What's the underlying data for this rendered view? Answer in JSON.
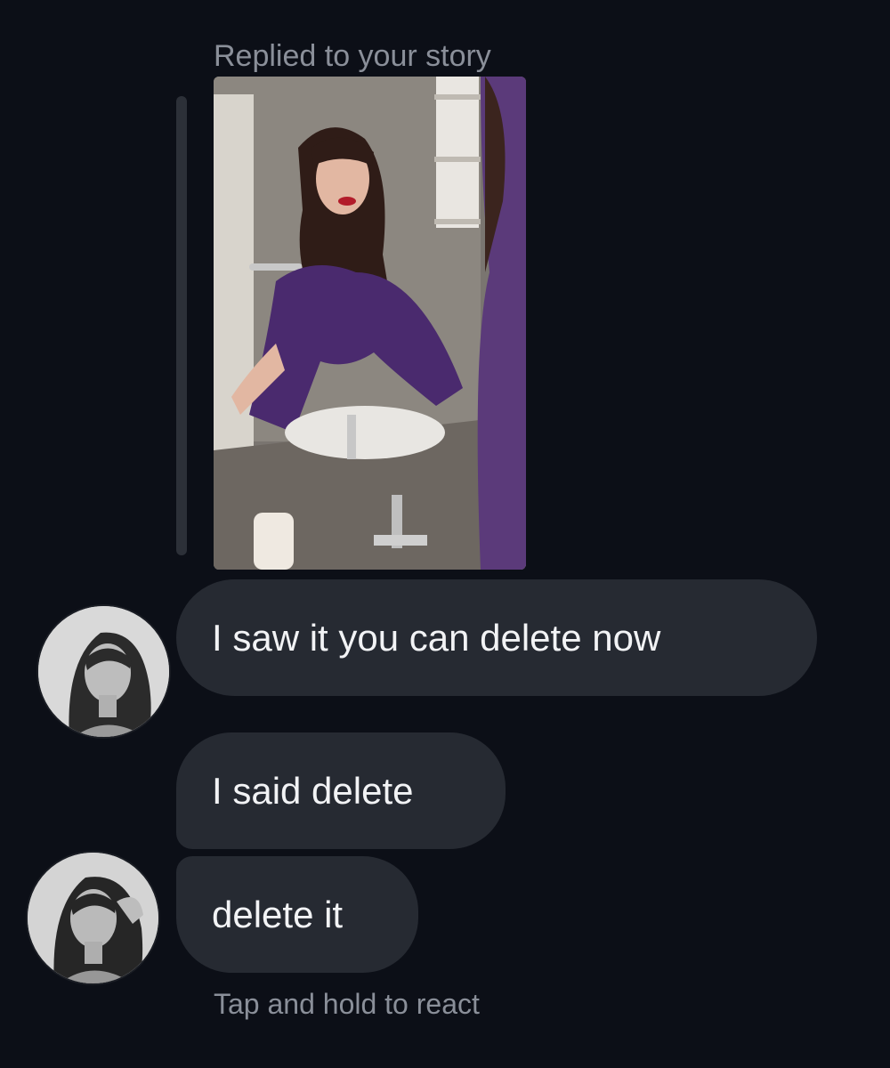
{
  "thread": {
    "replied_label": "Replied to your story",
    "story_thumbnail": "story-photo",
    "messages": [
      {
        "text": "I saw it you can delete now",
        "avatar": "profile-photo"
      },
      {
        "text": "I said delete"
      },
      {
        "text": "delete it",
        "avatar": "profile-photo"
      }
    ],
    "react_hint": "Tap and hold to react"
  },
  "colors": {
    "background": "#0c0f17",
    "bubble": "#262a32",
    "bubble_text": "#f2f3f5",
    "secondary_text": "#8a8f99",
    "reply_bar": "#2c3038"
  }
}
